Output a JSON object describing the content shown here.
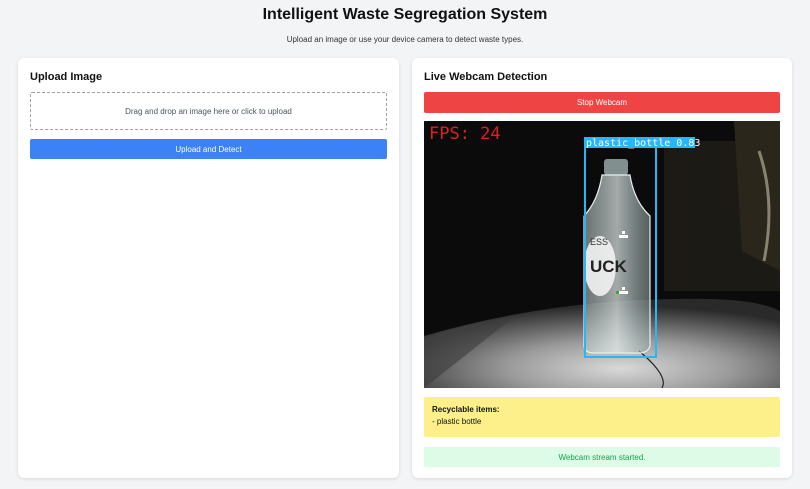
{
  "header": {
    "title": "Intelligent Waste Segregation System",
    "subtitle": "Upload an image or use your device camera to detect waste types."
  },
  "upload": {
    "title": "Upload Image",
    "dropzone_text": "Drag and drop an image here or click to upload",
    "button_label": "Upload and Detect"
  },
  "webcam": {
    "title": "Live Webcam Detection",
    "stop_label": "Stop Webcam",
    "fps_text": "FPS: 24",
    "detection_label": "plastic_bottle 0.83",
    "bottle_text": "UCK",
    "bottle_text_small": "ESS"
  },
  "results": {
    "recyclable_title": "Recyclable items:",
    "items": [
      "- plastic bottle"
    ]
  },
  "status": {
    "message": "Webcam stream started."
  },
  "colors": {
    "primary": "#3b82f6",
    "danger": "#ef4444",
    "warning_bg": "#fdf08a",
    "success_bg": "#dcfce7",
    "success_text": "#16a34a",
    "detection_box": "#29b6f6",
    "fps_text": "#e02020"
  }
}
